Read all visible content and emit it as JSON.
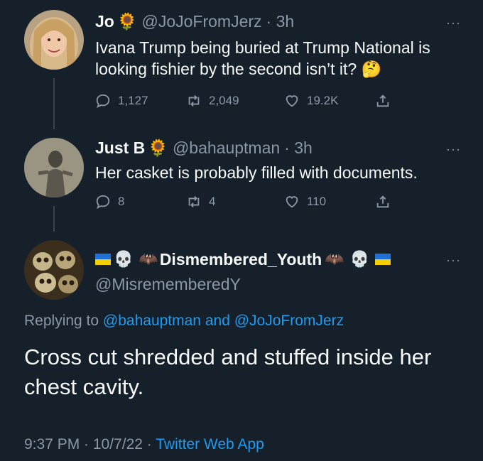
{
  "tweets": [
    {
      "name": "Jo",
      "handle": "@JoJoFromJerz",
      "time": "· 3h",
      "text": "Ivana Trump being buried at Trump National is looking fishier by the second isn’t it? 🤔",
      "replies": "1,127",
      "retweets": "2,049",
      "likes": "19.2K"
    },
    {
      "name": "Just B",
      "handle": "@bahauptman",
      "time": "· 3h",
      "text": "Her casket is probably filled with documents.",
      "replies": "8",
      "retweets": "4",
      "likes": "110"
    }
  ],
  "main_tweet": {
    "name": "Dismembered_Youth",
    "handle": "@MisrememberedY",
    "replying_prefix": "Replying to",
    "replying_user1": "@bahauptman",
    "replying_and": "and",
    "replying_user2": "@JoJoFromJerz",
    "text": "Cross cut shredded and stuffed inside her chest cavity.",
    "time": "9:37 PM · 10/7/22 ·",
    "source": "Twitter Web App"
  },
  "more_label": "···",
  "icons": {
    "sunflower": "🌻",
    "skull": "💀",
    "bat": "🦇",
    "thinking": "🤔"
  },
  "colors": {
    "background": "#15202b",
    "text": "#f7f9f9",
    "secondary": "#8b98a5",
    "link": "#1d9bf0",
    "thread_line": "#38444d"
  }
}
